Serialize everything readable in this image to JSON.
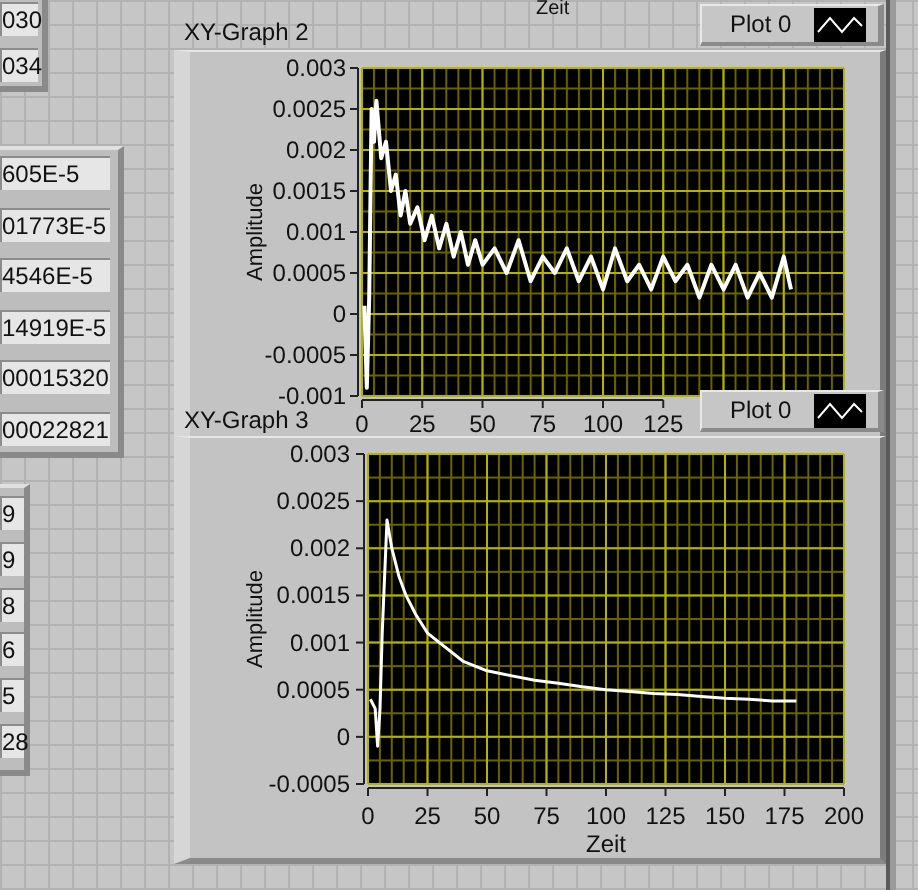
{
  "top_axis_label": "Zeit",
  "top_indicators": [
    {
      "value": "030"
    },
    {
      "value": "034"
    }
  ],
  "numeric_indicators": [
    {
      "value": "605E-5"
    },
    {
      "value": "01773E-5"
    },
    {
      "value": "4546E-5"
    },
    {
      "value": "14919E-5"
    },
    {
      "value": "00015320"
    },
    {
      "value": "00022821"
    }
  ],
  "small_indicators": [
    {
      "value": "9"
    },
    {
      "value": "9"
    },
    {
      "value": "8"
    },
    {
      "value": "6"
    },
    {
      "value": "5"
    },
    {
      "value": "28"
    }
  ],
  "graphs": [
    {
      "title": "XY-Graph 2",
      "chart_data": {
        "type": "line",
        "grid": true,
        "ylabel": "Amplitude",
        "xlim": [
          0,
          200
        ],
        "ylim": [
          -0.001,
          0.003
        ],
        "xticks": [
          0,
          25,
          50,
          75,
          100,
          125
        ],
        "yticks": [
          0.003,
          0.0025,
          0.002,
          0.0015,
          0.001,
          0.0005,
          0,
          -0.0005,
          -0.001
        ],
        "x": [
          1,
          2,
          3,
          4,
          5,
          6,
          8,
          10,
          12,
          14,
          16,
          18,
          20,
          23,
          26,
          29,
          32,
          35,
          38,
          41,
          44,
          47,
          50,
          55,
          60,
          65,
          70,
          75,
          80,
          85,
          90,
          95,
          100,
          105,
          110,
          115,
          120,
          125,
          130,
          135,
          140,
          145,
          150,
          155,
          160,
          165,
          170,
          175,
          178
        ],
        "series": [
          {
            "name": "Plot 0",
            "color": "#ffffff",
            "values": [
              0.0001,
              -0.0009,
              0.0002,
              0.0025,
              0.0021,
              0.0026,
              0.0019,
              0.0021,
              0.0015,
              0.0017,
              0.0012,
              0.0015,
              0.0011,
              0.0013,
              0.0009,
              0.0012,
              0.0008,
              0.0011,
              0.0007,
              0.001,
              0.0006,
              0.0009,
              0.0006,
              0.0008,
              0.0005,
              0.0009,
              0.0004,
              0.0007,
              0.0005,
              0.0008,
              0.0004,
              0.0007,
              0.0003,
              0.0008,
              0.0004,
              0.0006,
              0.0003,
              0.0007,
              0.0004,
              0.0006,
              0.0002,
              0.0006,
              0.0003,
              0.0006,
              0.0002,
              0.0005,
              0.0002,
              0.0007,
              0.0003
            ]
          }
        ]
      }
    },
    {
      "title": "XY-Graph 3",
      "chart_data": {
        "type": "line",
        "grid": true,
        "xlabel": "Zeit",
        "ylabel": "Amplitude",
        "xlim": [
          0,
          200
        ],
        "ylim": [
          -0.0005,
          0.003
        ],
        "xticks": [
          0,
          25,
          50,
          75,
          100,
          125,
          150,
          175,
          200
        ],
        "yticks": [
          0.003,
          0.0025,
          0.002,
          0.0015,
          0.001,
          0.0005,
          0,
          -0.0005
        ],
        "x": [
          1,
          3,
          4,
          5,
          6,
          8,
          10,
          13,
          16,
          20,
          25,
          30,
          35,
          40,
          45,
          50,
          60,
          70,
          80,
          90,
          100,
          110,
          120,
          130,
          140,
          150,
          160,
          170,
          180
        ],
        "series": [
          {
            "name": "Plot 0",
            "color": "#ffffff",
            "values": [
              0.0004,
              0.0003,
              -0.0001,
              0.0003,
              0.0011,
              0.0023,
              0.002,
              0.0017,
              0.0015,
              0.0013,
              0.0011,
              0.001,
              0.0009,
              0.0008,
              0.00075,
              0.0007,
              0.00065,
              0.0006,
              0.00057,
              0.00053,
              0.0005,
              0.00048,
              0.00046,
              0.00045,
              0.00043,
              0.00041,
              0.0004,
              0.00038,
              0.00038
            ]
          }
        ]
      }
    }
  ]
}
